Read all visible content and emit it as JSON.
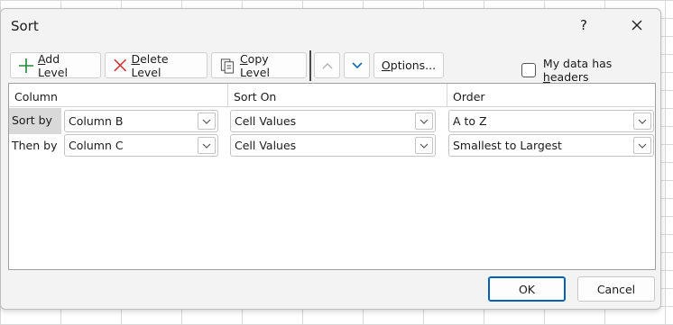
{
  "dialog": {
    "title": "Sort",
    "help_label": "?",
    "close_icon": "close-icon"
  },
  "toolbar": {
    "add_level_prefix": "",
    "add_level_accel": "A",
    "add_level_rest": "dd Level",
    "delete_level_accel": "D",
    "delete_level_rest": "elete Level",
    "copy_level_accel": "C",
    "copy_level_rest": "opy Level",
    "options_accel": "O",
    "options_rest": "ptions...",
    "my_data_prefix": "My data has ",
    "my_data_accel": "h",
    "my_data_rest": "eaders",
    "my_data_checked": false,
    "move_up_icon": "chevron-up-icon",
    "move_down_icon": "chevron-down-icon",
    "colors": {
      "add": "#1e8a3a",
      "delete": "#d13438",
      "down_arrow": "#0f6cbd"
    }
  },
  "grid": {
    "headers": {
      "column": "Column",
      "sort_on": "Sort On",
      "order": "Order"
    },
    "rows": [
      {
        "label": "Sort by",
        "column": "Column B",
        "sort_on": "Cell Values",
        "order": "A to Z"
      },
      {
        "label": "Then by",
        "column": "Column C",
        "sort_on": "Cell Values",
        "order": "Smallest to Largest"
      }
    ]
  },
  "buttons": {
    "ok": "OK",
    "cancel": "Cancel"
  }
}
